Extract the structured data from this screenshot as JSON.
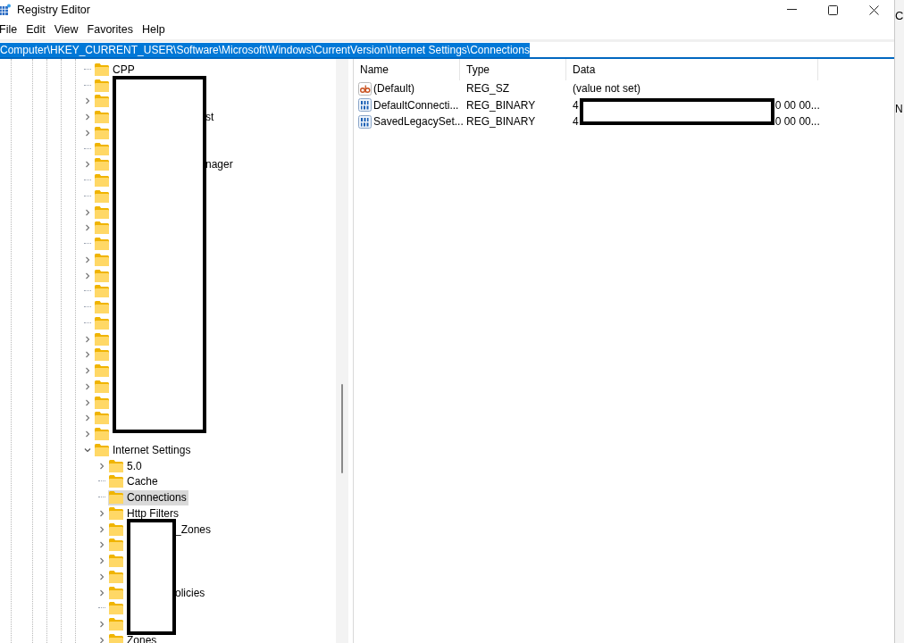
{
  "window": {
    "title": "Registry Editor"
  },
  "menu": [
    "File",
    "Edit",
    "View",
    "Favorites",
    "Help"
  ],
  "address": {
    "value": "Computer\\HKEY_CURRENT_USER\\Software\\Microsoft\\Windows\\CurrentVersion\\Internet Settings\\Connections",
    "selected": true
  },
  "tree": [
    {
      "label": "CPP",
      "has_children": false
    },
    {
      "has_children": false
    },
    {
      "has_children": true
    },
    {
      "label": "st",
      "obscured": true,
      "has_children": true
    },
    {
      "has_children": true
    },
    {
      "has_children": false
    },
    {
      "label": "nager",
      "obscured": true,
      "has_children": true
    },
    {
      "has_children": false
    },
    {
      "has_children": false
    },
    {
      "has_children": true
    },
    {
      "has_children": true
    },
    {
      "has_children": false
    },
    {
      "has_children": true
    },
    {
      "has_children": true
    },
    {
      "has_children": false
    },
    {
      "has_children": false
    },
    {
      "has_children": false
    },
    {
      "has_children": true
    },
    {
      "has_children": true
    },
    {
      "has_children": true
    },
    {
      "has_children": true
    },
    {
      "has_children": true
    },
    {
      "has_children": true
    },
    {
      "has_children": true
    },
    {
      "label": "Internet Settings",
      "has_children": true,
      "expanded": true,
      "children": [
        {
          "label": "5.0",
          "has_children": true,
          "selected": false
        },
        {
          "label": "Cache",
          "has_children": false,
          "selected": false
        },
        {
          "label": "Connections",
          "has_children": false,
          "selected": true
        },
        {
          "label": "Http Filters",
          "has_children": true,
          "selected": false
        },
        {
          "label": "_Zones",
          "obscured": true,
          "has_children": true,
          "selected": false
        },
        {
          "has_children": true,
          "selected": false
        },
        {
          "has_children": true,
          "selected": false
        },
        {
          "has_children": true,
          "selected": false
        },
        {
          "label": "olicies",
          "obscured": true,
          "has_children": true,
          "selected": false
        },
        {
          "has_children": false,
          "selected": false
        },
        {
          "has_children": true,
          "selected": false
        },
        {
          "label": "Zones",
          "has_children": true,
          "selected": false
        }
      ]
    }
  ],
  "values": {
    "columns": [
      "Name",
      "Type",
      "Data"
    ],
    "rows": [
      {
        "kind": "string",
        "name": "(Default)",
        "type": "REG_SZ",
        "data": "(value not set)"
      },
      {
        "kind": "binary",
        "name": "DefaultConnecti...",
        "type": "REG_BINARY",
        "data_prefix": "4",
        "data_suffix": "0 00 00...",
        "obscured": true
      },
      {
        "kind": "binary",
        "name": "SavedLegacySet...",
        "type": "REG_BINARY",
        "data_prefix": "4",
        "data_suffix": "0 00 00...",
        "obscured": true
      }
    ]
  },
  "background_window": {
    "texts": [
      "C",
      "N"
    ]
  }
}
